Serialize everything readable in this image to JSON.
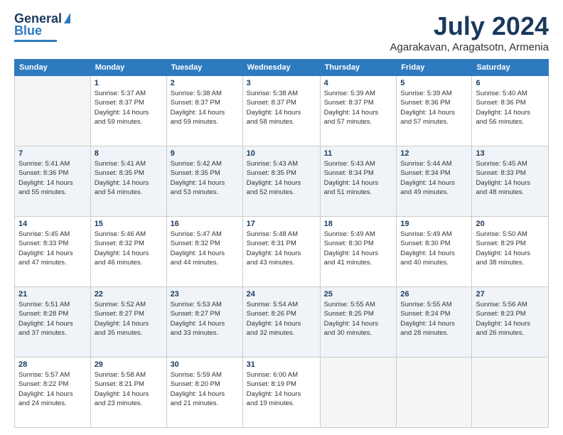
{
  "logo": {
    "general": "General",
    "blue": "Blue"
  },
  "title": "July 2024",
  "subtitle": "Agarakavan, Aragatsotn, Armenia",
  "days_of_week": [
    "Sunday",
    "Monday",
    "Tuesday",
    "Wednesday",
    "Thursday",
    "Friday",
    "Saturday"
  ],
  "weeks": [
    [
      {
        "num": "",
        "info": ""
      },
      {
        "num": "1",
        "info": "Sunrise: 5:37 AM\nSunset: 8:37 PM\nDaylight: 14 hours\nand 59 minutes."
      },
      {
        "num": "2",
        "info": "Sunrise: 5:38 AM\nSunset: 8:37 PM\nDaylight: 14 hours\nand 59 minutes."
      },
      {
        "num": "3",
        "info": "Sunrise: 5:38 AM\nSunset: 8:37 PM\nDaylight: 14 hours\nand 58 minutes."
      },
      {
        "num": "4",
        "info": "Sunrise: 5:39 AM\nSunset: 8:37 PM\nDaylight: 14 hours\nand 57 minutes."
      },
      {
        "num": "5",
        "info": "Sunrise: 5:39 AM\nSunset: 8:36 PM\nDaylight: 14 hours\nand 57 minutes."
      },
      {
        "num": "6",
        "info": "Sunrise: 5:40 AM\nSunset: 8:36 PM\nDaylight: 14 hours\nand 56 minutes."
      }
    ],
    [
      {
        "num": "7",
        "info": "Sunrise: 5:41 AM\nSunset: 8:36 PM\nDaylight: 14 hours\nand 55 minutes."
      },
      {
        "num": "8",
        "info": "Sunrise: 5:41 AM\nSunset: 8:35 PM\nDaylight: 14 hours\nand 54 minutes."
      },
      {
        "num": "9",
        "info": "Sunrise: 5:42 AM\nSunset: 8:35 PM\nDaylight: 14 hours\nand 53 minutes."
      },
      {
        "num": "10",
        "info": "Sunrise: 5:43 AM\nSunset: 8:35 PM\nDaylight: 14 hours\nand 52 minutes."
      },
      {
        "num": "11",
        "info": "Sunrise: 5:43 AM\nSunset: 8:34 PM\nDaylight: 14 hours\nand 51 minutes."
      },
      {
        "num": "12",
        "info": "Sunrise: 5:44 AM\nSunset: 8:34 PM\nDaylight: 14 hours\nand 49 minutes."
      },
      {
        "num": "13",
        "info": "Sunrise: 5:45 AM\nSunset: 8:33 PM\nDaylight: 14 hours\nand 48 minutes."
      }
    ],
    [
      {
        "num": "14",
        "info": "Sunrise: 5:45 AM\nSunset: 8:33 PM\nDaylight: 14 hours\nand 47 minutes."
      },
      {
        "num": "15",
        "info": "Sunrise: 5:46 AM\nSunset: 8:32 PM\nDaylight: 14 hours\nand 46 minutes."
      },
      {
        "num": "16",
        "info": "Sunrise: 5:47 AM\nSunset: 8:32 PM\nDaylight: 14 hours\nand 44 minutes."
      },
      {
        "num": "17",
        "info": "Sunrise: 5:48 AM\nSunset: 8:31 PM\nDaylight: 14 hours\nand 43 minutes."
      },
      {
        "num": "18",
        "info": "Sunrise: 5:49 AM\nSunset: 8:30 PM\nDaylight: 14 hours\nand 41 minutes."
      },
      {
        "num": "19",
        "info": "Sunrise: 5:49 AM\nSunset: 8:30 PM\nDaylight: 14 hours\nand 40 minutes."
      },
      {
        "num": "20",
        "info": "Sunrise: 5:50 AM\nSunset: 8:29 PM\nDaylight: 14 hours\nand 38 minutes."
      }
    ],
    [
      {
        "num": "21",
        "info": "Sunrise: 5:51 AM\nSunset: 8:28 PM\nDaylight: 14 hours\nand 37 minutes."
      },
      {
        "num": "22",
        "info": "Sunrise: 5:52 AM\nSunset: 8:27 PM\nDaylight: 14 hours\nand 35 minutes."
      },
      {
        "num": "23",
        "info": "Sunrise: 5:53 AM\nSunset: 8:27 PM\nDaylight: 14 hours\nand 33 minutes."
      },
      {
        "num": "24",
        "info": "Sunrise: 5:54 AM\nSunset: 8:26 PM\nDaylight: 14 hours\nand 32 minutes."
      },
      {
        "num": "25",
        "info": "Sunrise: 5:55 AM\nSunset: 8:25 PM\nDaylight: 14 hours\nand 30 minutes."
      },
      {
        "num": "26",
        "info": "Sunrise: 5:55 AM\nSunset: 8:24 PM\nDaylight: 14 hours\nand 28 minutes."
      },
      {
        "num": "27",
        "info": "Sunrise: 5:56 AM\nSunset: 8:23 PM\nDaylight: 14 hours\nand 26 minutes."
      }
    ],
    [
      {
        "num": "28",
        "info": "Sunrise: 5:57 AM\nSunset: 8:22 PM\nDaylight: 14 hours\nand 24 minutes."
      },
      {
        "num": "29",
        "info": "Sunrise: 5:58 AM\nSunset: 8:21 PM\nDaylight: 14 hours\nand 23 minutes."
      },
      {
        "num": "30",
        "info": "Sunrise: 5:59 AM\nSunset: 8:20 PM\nDaylight: 14 hours\nand 21 minutes."
      },
      {
        "num": "31",
        "info": "Sunrise: 6:00 AM\nSunset: 8:19 PM\nDaylight: 14 hours\nand 19 minutes."
      },
      {
        "num": "",
        "info": ""
      },
      {
        "num": "",
        "info": ""
      },
      {
        "num": "",
        "info": ""
      }
    ]
  ]
}
